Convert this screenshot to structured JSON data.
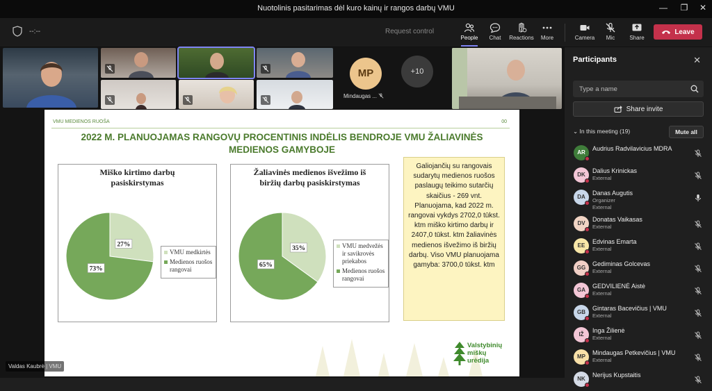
{
  "window": {
    "title": "Nuotolinis pasitarimas dėl kuro kainų ir rangos darbų VMU",
    "controls": [
      "—",
      "❐",
      "✕"
    ]
  },
  "toolbar": {
    "timer": "--:--",
    "request_control": "Request control",
    "buttons": [
      "People",
      "Chat",
      "Reactions",
      "More",
      "Camera",
      "Mic",
      "Share"
    ],
    "leave": "Leave"
  },
  "stage": {
    "tile_initials": "MP",
    "tile_name": "Mindaugas ...",
    "overflow": "+10",
    "speaker_label": "Valdas Kaubrė | VMU"
  },
  "slide": {
    "header_left": "VMU MEDIENOS RUOŠA",
    "header_right": "00",
    "title": "2022 M. PLANUOJAMAS RANGOVŲ PROCENTINIS INDĖLIS BENDROJE VMU ŽALIAVINĖS MEDIENOS GAMYBOJE",
    "note": "Galiojančių su rangovais sudarytų medienos ruošos paslaugų teikimo sutarčių skaičius - 269 vnt. Planuojama, kad 2022 m. rangovai vykdys 2702,0 tūkst. ktm miško kirtimo darbų ir 2407,0 tūkst. ktm žaliavinės medienos išvežimo iš biržių darbų. Viso VMU planuojama gamyba: 3700,0 tūkst. ktm",
    "logo_lines": [
      "Valstybinių",
      "miškų",
      "urėdija"
    ]
  },
  "chart_data": [
    {
      "type": "pie",
      "title": "Miško kirtimo darbų pasiskirstymas",
      "categories": [
        "VMU medkirtės",
        "Medienos ruošos rangovai"
      ],
      "values": [
        27,
        73
      ],
      "labels": [
        "27%",
        "73%"
      ],
      "colors": [
        "#cfe0bd",
        "#76a85a"
      ],
      "legend_position": "right"
    },
    {
      "type": "pie",
      "title": "Žaliavinės medienos išvežimo iš biržių darbų pasiskirstymas",
      "categories": [
        "VMU medvežės ir savikrovės priekabos",
        "Medienos ruošos rangovai"
      ],
      "values": [
        35,
        65
      ],
      "labels": [
        "35%",
        "65%"
      ],
      "colors": [
        "#cfe0bd",
        "#76a85a"
      ],
      "legend_position": "right"
    }
  ],
  "panel": {
    "title": "Participants",
    "search_placeholder": "Type a name",
    "share_invite": "Share invite",
    "in_meeting": "In this meeting (19)",
    "mute_all": "Mute all",
    "participants": [
      {
        "initials": "AR",
        "name": "Audrius Radvilavicius MDRA",
        "sub": "",
        "sub2": "",
        "color": "#3f7d3a",
        "mic": "muted"
      },
      {
        "initials": "DK",
        "name": "Dalius Krinickas",
        "sub": "External",
        "sub2": "",
        "color": "#f3c6d6",
        "mic": "muted"
      },
      {
        "initials": "DA",
        "name": "Danas Augutis",
        "sub": "Organizer",
        "sub2": "External",
        "color": "#c8d7ea",
        "mic": "on"
      },
      {
        "initials": "DV",
        "name": "Donatas Vaikasas",
        "sub": "External",
        "sub2": "",
        "color": "#f1d4c4",
        "mic": "muted"
      },
      {
        "initials": "EE",
        "name": "Edvinas Emarta",
        "sub": "External",
        "sub2": "",
        "color": "#f8e7a8",
        "mic": "muted"
      },
      {
        "initials": "GG",
        "name": "Gediminas Golcevas",
        "sub": "External",
        "sub2": "",
        "color": "#f1cfc6",
        "mic": "muted"
      },
      {
        "initials": "GA",
        "name": "GEDVILIENĖ Aistė",
        "sub": "External",
        "sub2": "",
        "color": "#f3c6d6",
        "mic": "muted"
      },
      {
        "initials": "GB",
        "name": "Gintaras Bacevičius | VMU",
        "sub": "External",
        "sub2": "",
        "color": "#c8d7ea",
        "mic": "muted"
      },
      {
        "initials": "IŽ",
        "name": "Inga Žilienė",
        "sub": "External",
        "sub2": "",
        "color": "#f3c6d6",
        "mic": "muted"
      },
      {
        "initials": "MP",
        "name": "Mindaugas Petkevičius | VMU",
        "sub": "External",
        "sub2": "",
        "color": "#f8e0a8",
        "mic": "muted"
      },
      {
        "initials": "NK",
        "name": "Nerijus Kupstaitis",
        "sub": "",
        "sub2": "",
        "color": "#d5dbe6",
        "mic": "muted"
      }
    ]
  }
}
